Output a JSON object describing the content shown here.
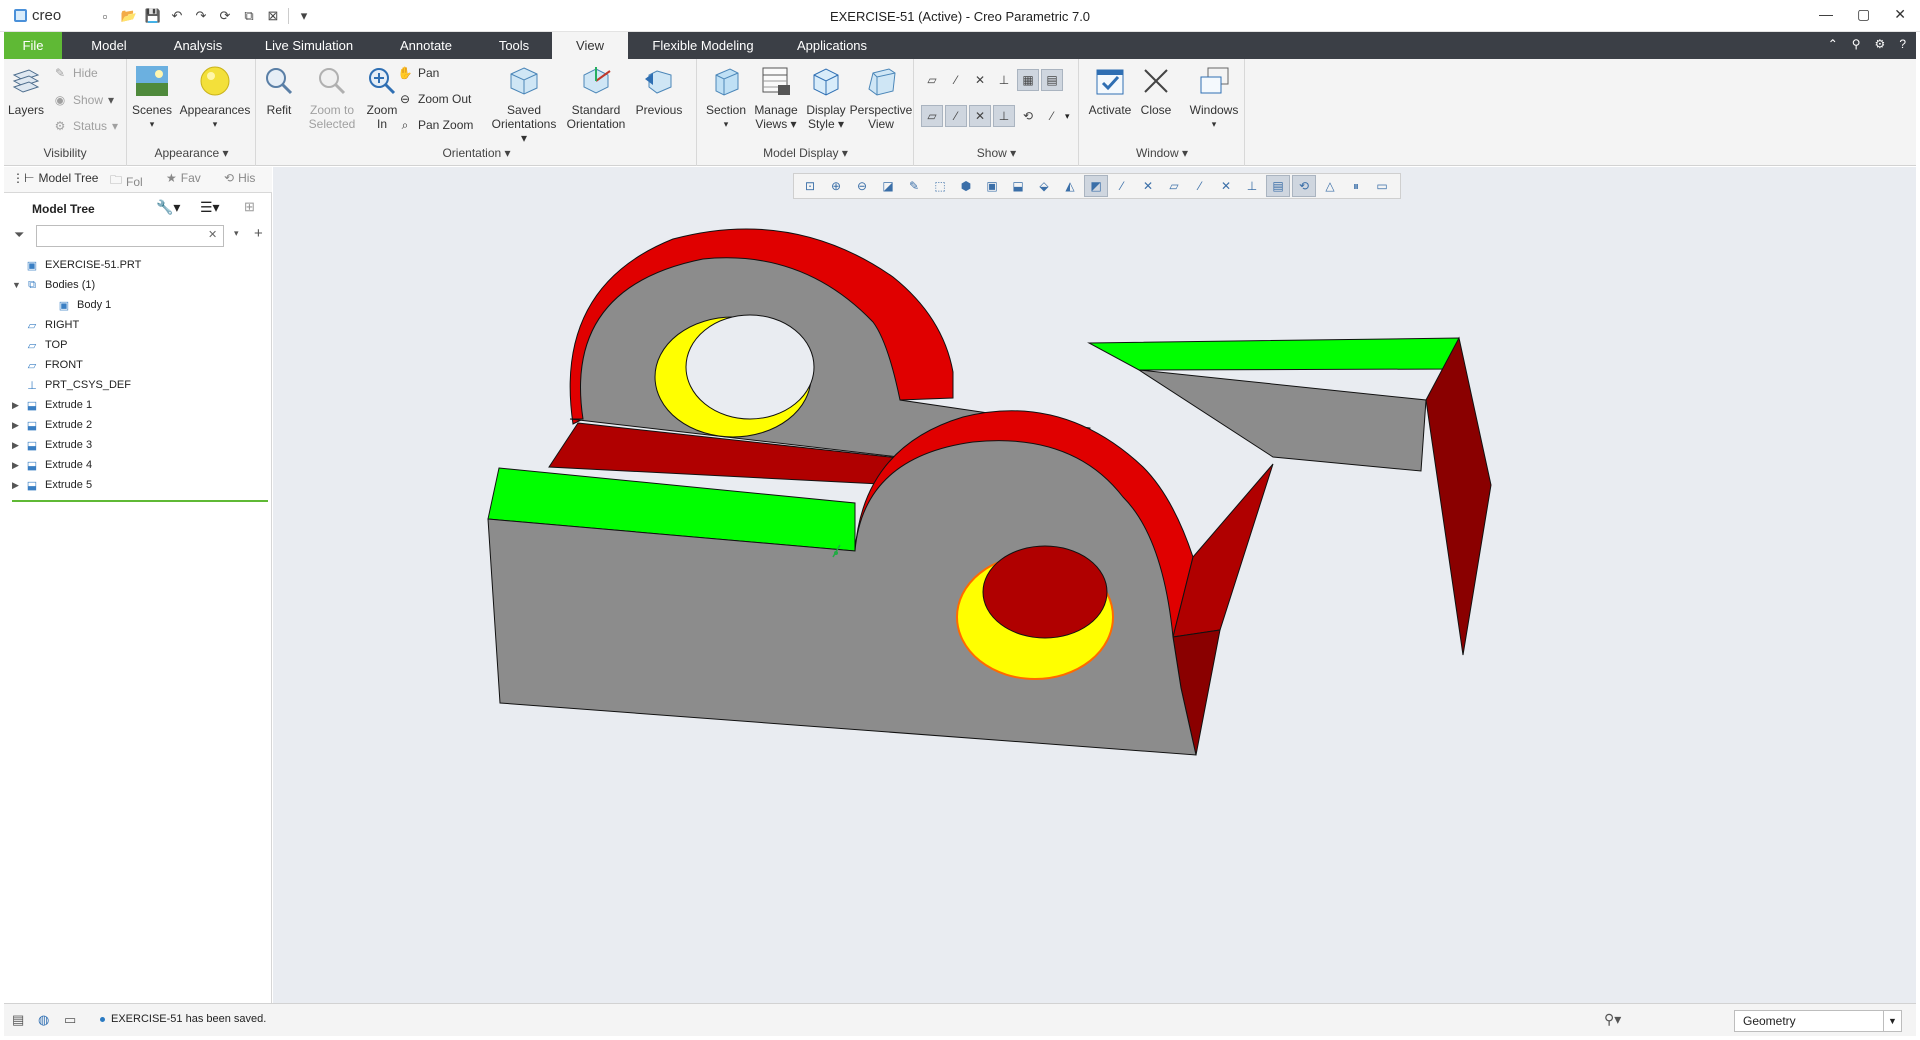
{
  "app": {
    "logo": "creo",
    "window_title": "EXERCISE-51 (Active) - Creo Parametric 7.0"
  },
  "tabs": [
    {
      "label": "File"
    },
    {
      "label": "Model"
    },
    {
      "label": "Analysis"
    },
    {
      "label": "Live Simulation"
    },
    {
      "label": "Annotate"
    },
    {
      "label": "Tools"
    },
    {
      "label": "View"
    },
    {
      "label": "Flexible Modeling"
    },
    {
      "label": "Applications"
    }
  ],
  "ribbon": {
    "visibility": {
      "label": "Visibility",
      "layers": "Layers",
      "hide": "Hide",
      "show": "Show",
      "status": "Status"
    },
    "appearance": {
      "label": "Appearance",
      "scenes": "Scenes",
      "appearances": "Appearances"
    },
    "orientation": {
      "label": "Orientation",
      "refit": "Refit",
      "zoom_selected_1": "Zoom to",
      "zoom_selected_2": "Selected",
      "zoom_in_1": "Zoom",
      "zoom_in_2": "In",
      "pan": "Pan",
      "zoom_out": "Zoom Out",
      "pan_zoom": "Pan Zoom",
      "saved_1": "Saved",
      "saved_2": "Orientations",
      "standard_1": "Standard",
      "standard_2": "Orientation",
      "previous": "Previous"
    },
    "model_display": {
      "label": "Model Display",
      "section": "Section",
      "manage_1": "Manage",
      "manage_2": "Views",
      "display_1": "Display",
      "display_2": "Style",
      "perspective_1": "Perspective",
      "perspective_2": "View"
    },
    "show": {
      "label": "Show"
    },
    "window": {
      "label": "Window",
      "activate": "Activate",
      "close": "Close",
      "windows": "Windows"
    }
  },
  "left_panel": {
    "tabs": {
      "model_tree": "Model Tree",
      "folder": "Fol",
      "favorites": "Fav",
      "history": "His"
    },
    "header": "Model Tree",
    "search_placeholder": "",
    "tree": [
      {
        "label": "EXERCISE-51.PRT",
        "icon": "part-icon",
        "expander": ""
      },
      {
        "label": "Bodies (1)",
        "icon": "bodies-icon",
        "expander": "▼"
      },
      {
        "label": "Body 1",
        "icon": "body-icon",
        "expander": ""
      },
      {
        "label": "RIGHT",
        "icon": "datum-plane-icon",
        "expander": ""
      },
      {
        "label": "TOP",
        "icon": "datum-plane-icon",
        "expander": ""
      },
      {
        "label": "FRONT",
        "icon": "datum-plane-icon",
        "expander": ""
      },
      {
        "label": "PRT_CSYS_DEF",
        "icon": "csys-icon",
        "expander": ""
      },
      {
        "label": "Extrude 1",
        "icon": "extrude-icon",
        "expander": "▶"
      },
      {
        "label": "Extrude 2",
        "icon": "extrude-icon",
        "expander": "▶"
      },
      {
        "label": "Extrude 3",
        "icon": "extrude-icon",
        "expander": "▶"
      },
      {
        "label": "Extrude 4",
        "icon": "extrude-icon",
        "expander": "▶"
      },
      {
        "label": "Extrude 5",
        "icon": "extrude-icon",
        "expander": "▶"
      }
    ]
  },
  "status": {
    "message": "EXERCISE-51 has been saved.",
    "filter_value": "Geometry"
  },
  "colors": {
    "file_tab": "#5fb935",
    "tab_bar": "#3b3f46",
    "model_gray": "#8c8c8c",
    "model_red": "#e00000",
    "model_green": "#00ff00",
    "model_yellow": "#ffff00"
  }
}
